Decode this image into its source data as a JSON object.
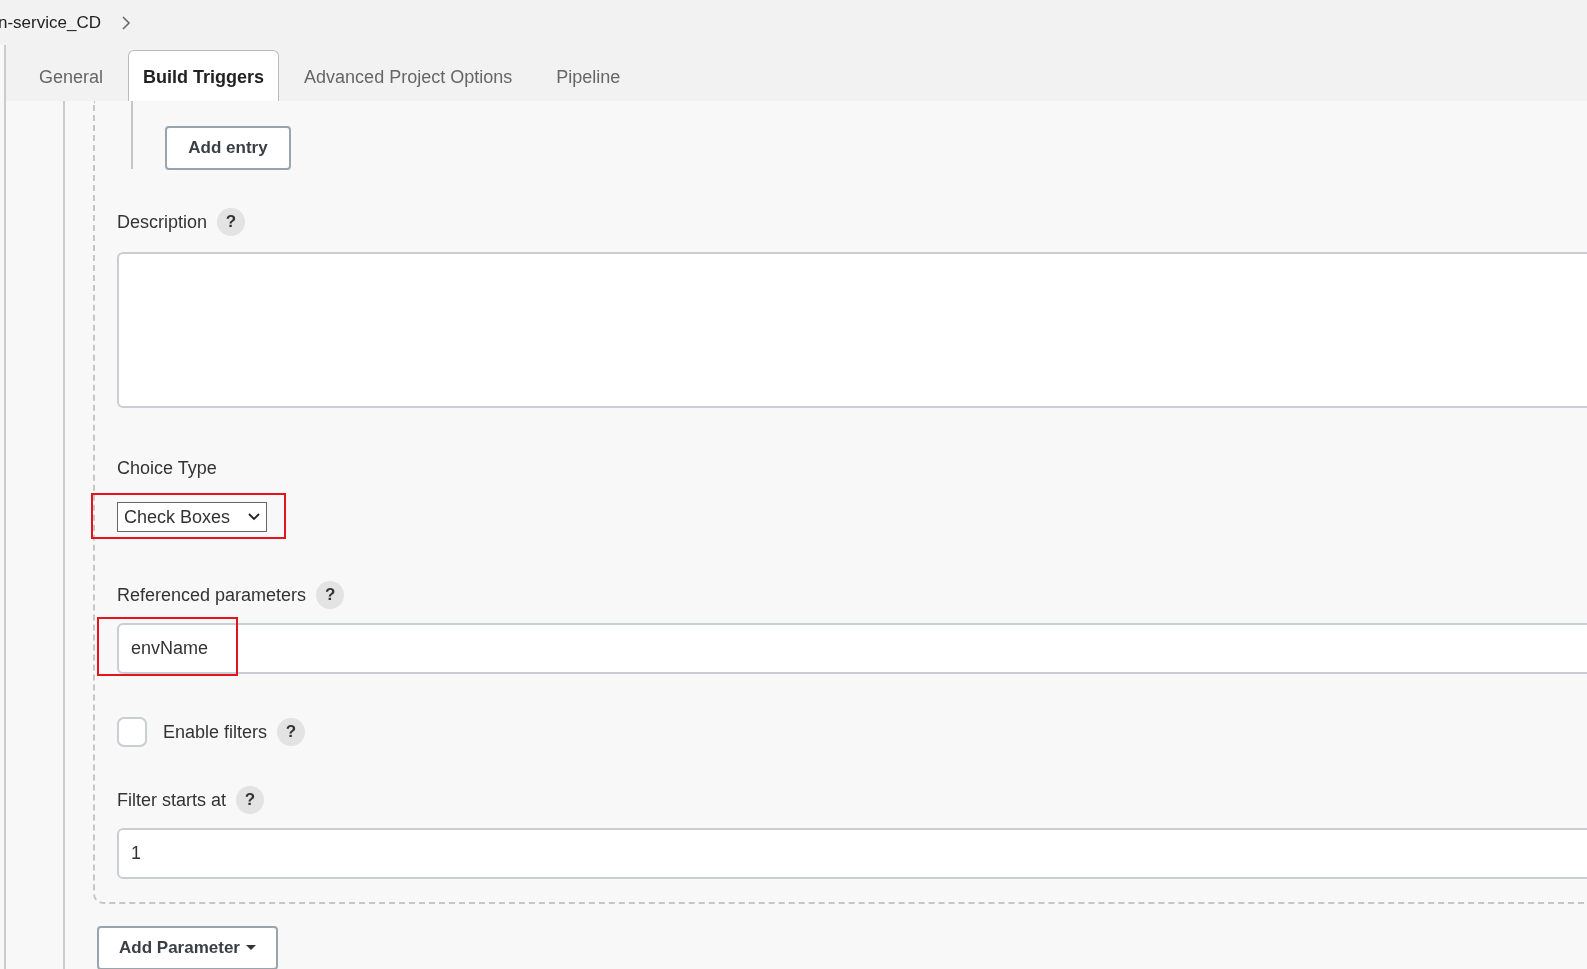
{
  "breadcrumb": {
    "text": "n-service_CD"
  },
  "tabs": [
    {
      "label": "General",
      "selected": false
    },
    {
      "label": "Build Triggers",
      "selected": true
    },
    {
      "label": "Advanced Project Options",
      "selected": false
    },
    {
      "label": "Pipeline",
      "selected": false
    }
  ],
  "add_entry_button": "Add entry",
  "fields": [
    {
      "kind": "textarea",
      "label": "Description",
      "help": "?"
    },
    {
      "kind": "select",
      "label": "Choice Type",
      "value": "Check Boxes",
      "highlighted": true
    },
    {
      "kind": "text",
      "label": "Referenced parameters",
      "help": "?",
      "value": "envName",
      "highlighted": true
    },
    {
      "kind": "checkbox",
      "label": "Enable filters",
      "help": "?",
      "checked": false
    },
    {
      "kind": "text",
      "label": "Filter starts at",
      "help": "?",
      "value": "1",
      "highlighted": false
    }
  ],
  "add_parameter_button": "Add Parameter"
}
